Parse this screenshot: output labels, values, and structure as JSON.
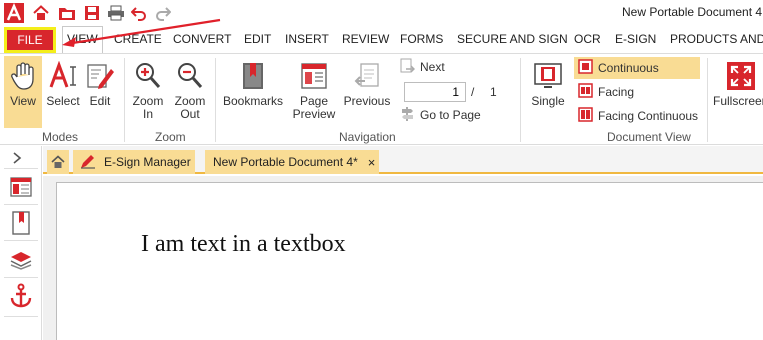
{
  "window": {
    "title": "New Portable Document 4"
  },
  "tabs": [
    {
      "label": "FILE"
    },
    {
      "label": "VIEW"
    },
    {
      "label": "CREATE"
    },
    {
      "label": "CONVERT"
    },
    {
      "label": "EDIT"
    },
    {
      "label": "INSERT"
    },
    {
      "label": "REVIEW"
    },
    {
      "label": "FORMS"
    },
    {
      "label": "SECURE AND SIGN"
    },
    {
      "label": "OCR"
    },
    {
      "label": "E-SIGN"
    },
    {
      "label": "PRODUCTS AND I"
    }
  ],
  "ribbon": {
    "modes": {
      "label": "Modes",
      "view": "View",
      "select": "Select",
      "edit": "Edit"
    },
    "zoom": {
      "label": "Zoom",
      "zoom_in_1": "Zoom",
      "zoom_in_2": "In",
      "zoom_out_1": "Zoom",
      "zoom_out_2": "Out"
    },
    "navigation": {
      "label": "Navigation",
      "bookmarks": "Bookmarks",
      "page_preview_1": "Page",
      "page_preview_2": "Preview",
      "previous": "Previous",
      "next": "Next",
      "current_page": "1",
      "separator": "/",
      "total_pages": "1",
      "go_to_page": "Go to Page"
    },
    "document_view": {
      "label": "Document View",
      "single": "Single",
      "continuous": "Continuous",
      "facing": "Facing",
      "facing_continuous": "Facing Continuous"
    },
    "fullscreen": "Fullscreen"
  },
  "doc_tabs": {
    "esign_manager": "E-Sign Manager",
    "document": "New Portable Document 4*",
    "close": "×"
  },
  "page": {
    "textbox": "I am text in a textbox"
  },
  "colors": {
    "accent_red": "#d8262c",
    "highlight_yellow": "#f9dc94",
    "annotation_yellow": "#f4ee1a",
    "tab_underline": "#f0b840"
  }
}
